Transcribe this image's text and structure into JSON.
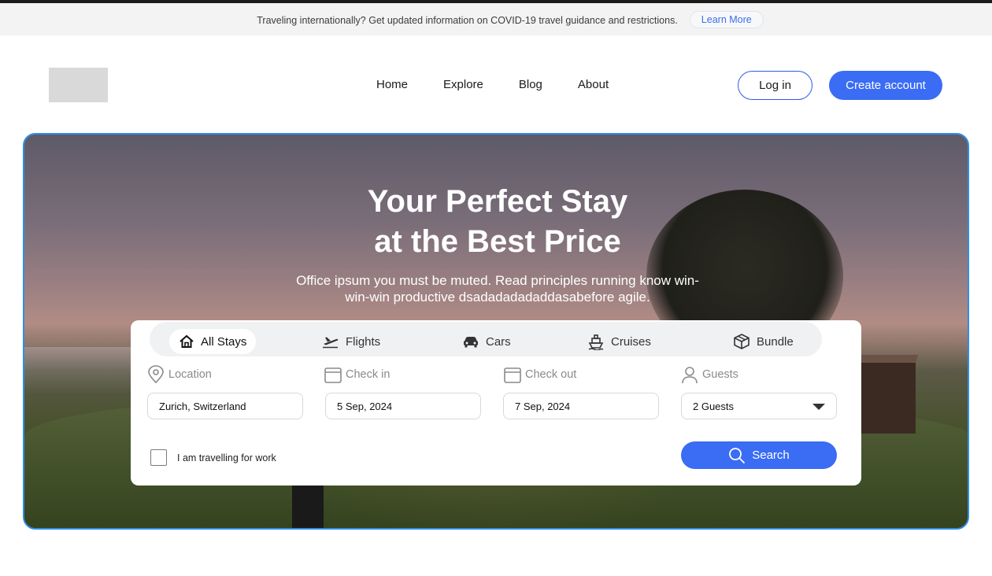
{
  "notice": {
    "text": "Traveling internationally? Get updated information on COVID-19 travel guidance and restrictions.",
    "link_label": "Learn More"
  },
  "nav": {
    "items": [
      {
        "label": "Home"
      },
      {
        "label": "Explore"
      },
      {
        "label": "Blog"
      },
      {
        "label": "About"
      }
    ],
    "login_label": "Log in",
    "create_account_label": "Create account"
  },
  "hero": {
    "title_line1": "Your Perfect Stay",
    "title_line2": "at the Best Price",
    "subtitle_line1": "Office ipsum you must be muted. Read principles running know win-",
    "subtitle_line2": "win-win productive dsadadadadaddasabefore agile."
  },
  "search": {
    "tabs": [
      {
        "label": "All Stays",
        "icon": "home-icon",
        "active": true
      },
      {
        "label": "Flights",
        "icon": "plane-icon",
        "active": false
      },
      {
        "label": "Cars",
        "icon": "car-icon",
        "active": false
      },
      {
        "label": "Cruises",
        "icon": "ship-icon",
        "active": false
      },
      {
        "label": "Bundle",
        "icon": "box-icon",
        "active": false
      }
    ],
    "location": {
      "label": "Location",
      "value": "Zurich, Switzerland"
    },
    "check_in": {
      "label": "Check in",
      "value": "5 Sep, 2024"
    },
    "check_out": {
      "label": "Check out",
      "value": "7 Sep, 2024"
    },
    "guests": {
      "label": "Guests",
      "value": "2 Guests"
    },
    "work_checkbox_label": "I am travelling for work",
    "search_label": "Search"
  },
  "colors": {
    "accent": "#3a6cf4",
    "hero_border": "#2f8ee8"
  }
}
